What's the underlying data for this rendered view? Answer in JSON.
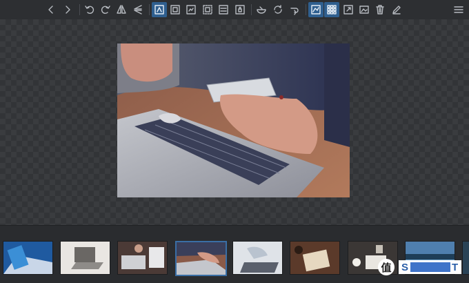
{
  "toolbar": {
    "icons": [
      "chevron-left-icon",
      "chevron-right-icon",
      "rotate-left-icon",
      "rotate-right-icon",
      "flip-horizontal-icon",
      "flip-vertical-icon",
      "fit-window-icon",
      "actual-size-icon",
      "zoom-fit-width-icon",
      "zoom-fit-height-icon",
      "crop-icon",
      "lock-icon",
      "bowl-icon",
      "refresh-icon",
      "redo-icon",
      "histogram-icon",
      "grid-icon",
      "fullscreen-icon",
      "image-edit-icon",
      "trash-icon",
      "pen-icon",
      "menu-icon"
    ],
    "accent": "#2f5f8f"
  },
  "viewer": {
    "image_subject": "hands-with-phone-and-laptop",
    "background": "checkerboard"
  },
  "filmstrip": {
    "thumbnails": [
      "phone-on-keyboard",
      "laptop-on-desk",
      "laptop-and-phone",
      "phone-and-laptop-selected",
      "typing-on-laptop",
      "notebook-and-coffee",
      "desk-workspace",
      "lake-landscape"
    ],
    "selected_index": 3
  },
  "watermark": {
    "logo_char": "值",
    "text_start": "S",
    "text_end": "T"
  }
}
